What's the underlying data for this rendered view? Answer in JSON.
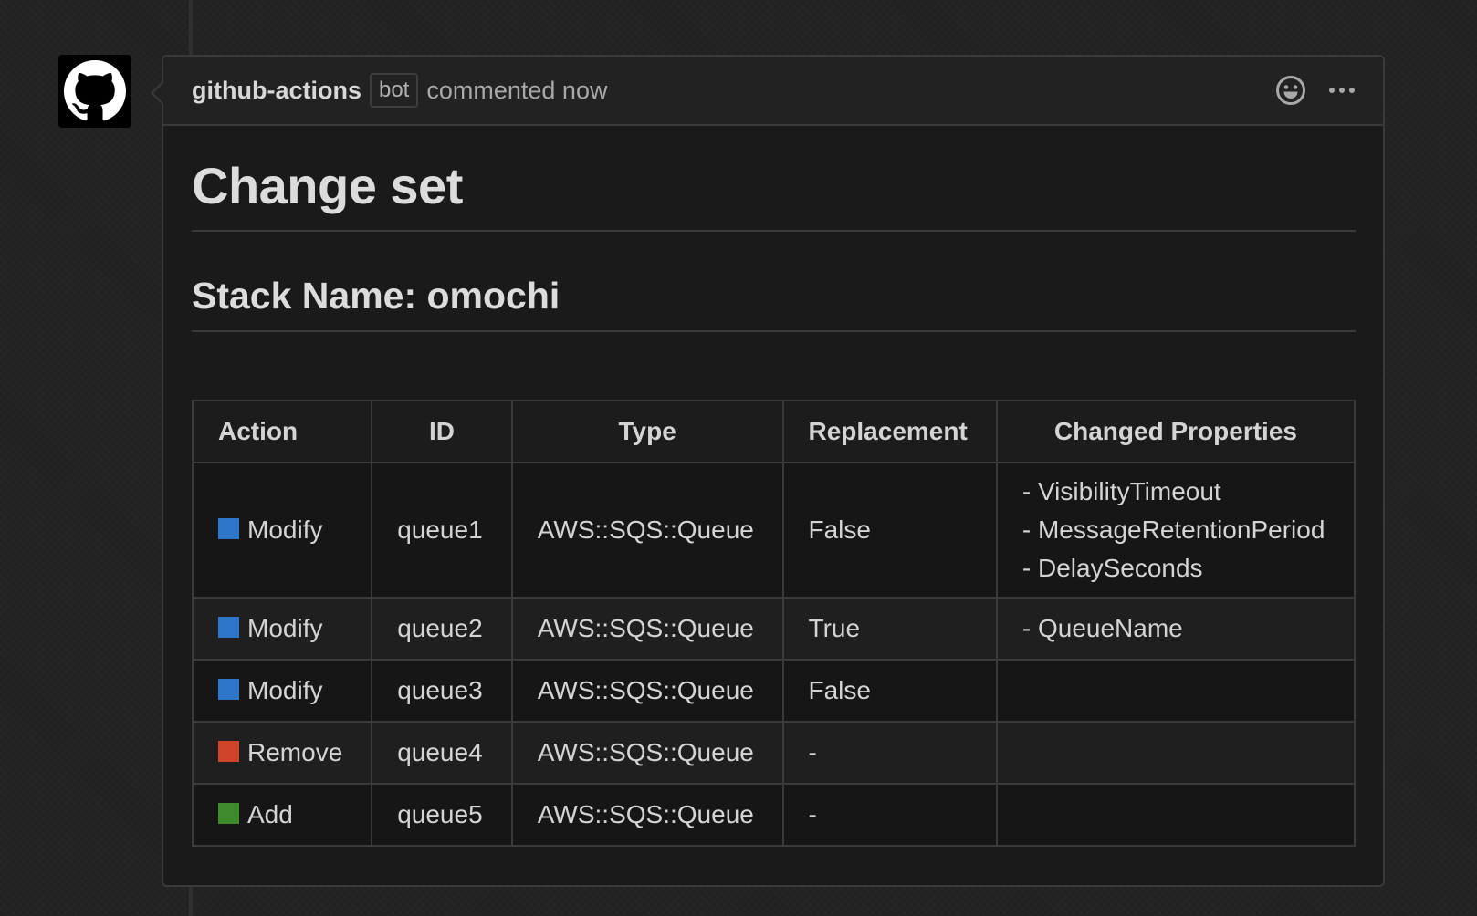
{
  "comment": {
    "author": "github-actions",
    "badge": "bot",
    "meta": "commented now"
  },
  "body": {
    "title": "Change set",
    "subtitle": "Stack Name: omochi"
  },
  "table": {
    "headers": {
      "action": "Action",
      "id": "ID",
      "type": "Type",
      "replacement": "Replacement",
      "changed_properties": "Changed Properties"
    },
    "rows": [
      {
        "action": "Modify",
        "action_color": "#2f76c8",
        "id": "queue1",
        "type": "AWS::SQS::Queue",
        "replacement": "False",
        "props": [
          "- VisibilityTimeout",
          "- MessageRetentionPeriod",
          "- DelaySeconds"
        ]
      },
      {
        "action": "Modify",
        "action_color": "#2f76c8",
        "id": "queue2",
        "type": "AWS::SQS::Queue",
        "replacement": "True",
        "props": [
          "- QueueName"
        ]
      },
      {
        "action": "Modify",
        "action_color": "#2f76c8",
        "id": "queue3",
        "type": "AWS::SQS::Queue",
        "replacement": "False",
        "props": []
      },
      {
        "action": "Remove",
        "action_color": "#d0442c",
        "id": "queue4",
        "type": "AWS::SQS::Queue",
        "replacement": "-",
        "props": []
      },
      {
        "action": "Add",
        "action_color": "#3d8b2a",
        "id": "queue5",
        "type": "AWS::SQS::Queue",
        "replacement": "-",
        "props": []
      }
    ]
  },
  "icons": {
    "avatar": "github-octocat-icon",
    "reaction": "smiley-icon",
    "more": "kebab-horizontal-icon"
  }
}
